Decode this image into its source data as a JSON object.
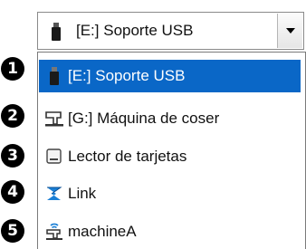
{
  "combo": {
    "selected_label": "[E:] Soporte USB",
    "icon": "usb-drive-icon"
  },
  "items": [
    {
      "number": "1",
      "label": "[E:] Soporte USB",
      "icon": "usb-drive-icon",
      "selected": true
    },
    {
      "number": "2",
      "label": "[G:] Máquina de coser",
      "icon": "sewing-machine-drive-icon",
      "selected": false
    },
    {
      "number": "3",
      "label": "Lector de tarjetas",
      "icon": "card-reader-icon",
      "selected": false
    },
    {
      "number": "4",
      "label": "Link",
      "icon": "link-icon",
      "selected": false
    },
    {
      "number": "5",
      "label": "machineA",
      "icon": "network-machine-icon",
      "selected": false
    }
  ],
  "colors": {
    "selection": "#0a67c7",
    "link_icon": "#1a7fd6"
  }
}
